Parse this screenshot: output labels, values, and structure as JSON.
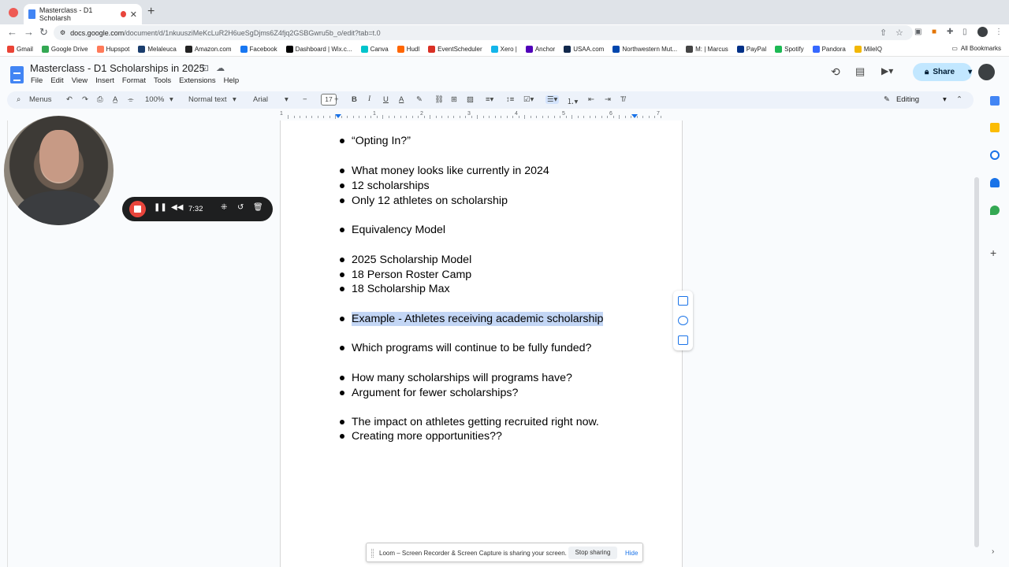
{
  "browser": {
    "tab_title": "Masterclass - D1 Scholarsh",
    "url_host": "docs.google.com",
    "url_path": "/document/d/1nkuusziMeKcLuR2H6ueSgDjms6Z4fjq2GSBGwru5b_o/edit?tab=t.0",
    "bookmarks": [
      {
        "label": "Gmail",
        "color": "#ea4335"
      },
      {
        "label": "Google Drive",
        "color": "#34a853"
      },
      {
        "label": "Hupspot",
        "color": "#ff7a59"
      },
      {
        "label": "Melaleuca",
        "color": "#1a3d6d"
      },
      {
        "label": "Amazon.com",
        "color": "#222222"
      },
      {
        "label": "Facebook",
        "color": "#1877f2"
      },
      {
        "label": "Dashboard | Wix.c...",
        "color": "#000000"
      },
      {
        "label": "Canva",
        "color": "#00c4cc"
      },
      {
        "label": "Hudl",
        "color": "#ff6600"
      },
      {
        "label": "EventScheduler",
        "color": "#d93025"
      },
      {
        "label": "Xero |",
        "color": "#13b5ea"
      },
      {
        "label": "Anchor",
        "color": "#5000b9"
      },
      {
        "label": "USAA.com",
        "color": "#12284c"
      },
      {
        "label": "Northwestern Mut...",
        "color": "#0046ad"
      },
      {
        "label": "M: | Marcus",
        "color": "#444444"
      },
      {
        "label": "PayPal",
        "color": "#003087"
      },
      {
        "label": "Spotify",
        "color": "#1db954"
      },
      {
        "label": "Pandora",
        "color": "#3668ff"
      },
      {
        "label": "MileIQ",
        "color": "#f2b705"
      }
    ],
    "all_bookmarks": "All Bookmarks"
  },
  "docs": {
    "title": "Masterclass - D1 Scholarships in 2025",
    "menus": [
      "File",
      "Edit",
      "View",
      "Insert",
      "Format",
      "Tools",
      "Extensions",
      "Help"
    ],
    "share_label": "Share",
    "toolbar": {
      "menus_label": "Menus",
      "zoom": "100%",
      "style": "Normal text",
      "font": "Arial",
      "font_size": "17",
      "mode": "Editing"
    },
    "ruler_numbers": [
      "1",
      "1",
      "2",
      "3",
      "4",
      "5",
      "6",
      "7"
    ]
  },
  "document": {
    "bullets": [
      {
        "text": "“Opting In?”",
        "highlighted": false
      },
      {
        "text": "What money looks like currently in 2024",
        "highlighted": false
      },
      {
        "text": "12 scholarships",
        "highlighted": false
      },
      {
        "text": "Only 12 athletes on scholarship",
        "highlighted": false
      },
      {
        "text": "Equivalency Model",
        "highlighted": false
      },
      {
        "text": "2025 Scholarship Model",
        "highlighted": false
      },
      {
        "text": "18 Person Roster Camp",
        "highlighted": false
      },
      {
        "text": "18 Scholarship Max",
        "highlighted": false
      },
      {
        "text": "Example - Athletes receiving academic scholarship",
        "highlighted": true
      },
      {
        "text": "Which programs will continue to be fully funded?",
        "highlighted": false
      },
      {
        "text": "How many scholarships will programs have?",
        "highlighted": false
      },
      {
        "text": "Argument for fewer scholarships?",
        "highlighted": false
      },
      {
        "text": "The impact on athletes getting recruited right now.",
        "highlighted": false
      },
      {
        "text": "Creating more opportunities??",
        "highlighted": false
      }
    ]
  },
  "loom": {
    "timer": "7:32",
    "sharing_message": "Loom – Screen Recorder & Screen Capture is sharing your screen.",
    "stop_sharing": "Stop sharing",
    "hide": "Hide"
  }
}
